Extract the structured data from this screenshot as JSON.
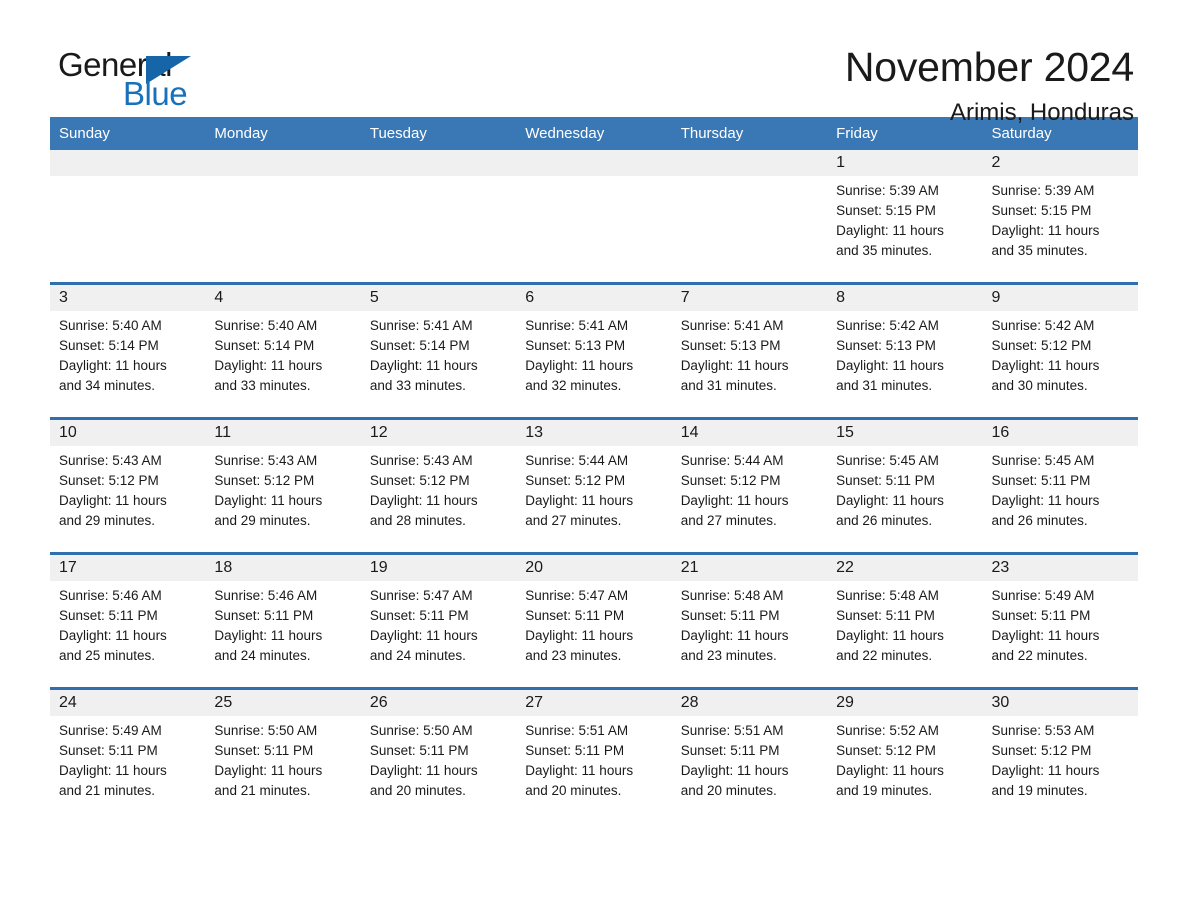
{
  "brand": {
    "name_top": "General",
    "name_bottom": "Blue",
    "triangle_color": "#1565a8",
    "blue_color": "#1772bb"
  },
  "header": {
    "title": "November 2024",
    "subtitle": "Arimis, Honduras"
  },
  "theme": {
    "header_row_bg": "#3a78b5",
    "week_divider": "#2f6fb0",
    "daynum_band_bg": "#f0f0f0",
    "text": "#1a1a1a"
  },
  "weekday_headers": [
    "Sunday",
    "Monday",
    "Tuesday",
    "Wednesday",
    "Thursday",
    "Friday",
    "Saturday"
  ],
  "weeks": [
    [
      {
        "day": "",
        "empty": true,
        "lines": []
      },
      {
        "day": "",
        "empty": true,
        "lines": []
      },
      {
        "day": "",
        "empty": true,
        "lines": []
      },
      {
        "day": "",
        "empty": true,
        "lines": []
      },
      {
        "day": "",
        "empty": true,
        "lines": []
      },
      {
        "day": "1",
        "empty": false,
        "lines": [
          "Sunrise: 5:39 AM",
          "Sunset: 5:15 PM",
          "Daylight: 11 hours",
          "and 35 minutes."
        ]
      },
      {
        "day": "2",
        "empty": false,
        "lines": [
          "Sunrise: 5:39 AM",
          "Sunset: 5:15 PM",
          "Daylight: 11 hours",
          "and 35 minutes."
        ]
      }
    ],
    [
      {
        "day": "3",
        "empty": false,
        "lines": [
          "Sunrise: 5:40 AM",
          "Sunset: 5:14 PM",
          "Daylight: 11 hours",
          "and 34 minutes."
        ]
      },
      {
        "day": "4",
        "empty": false,
        "lines": [
          "Sunrise: 5:40 AM",
          "Sunset: 5:14 PM",
          "Daylight: 11 hours",
          "and 33 minutes."
        ]
      },
      {
        "day": "5",
        "empty": false,
        "lines": [
          "Sunrise: 5:41 AM",
          "Sunset: 5:14 PM",
          "Daylight: 11 hours",
          "and 33 minutes."
        ]
      },
      {
        "day": "6",
        "empty": false,
        "lines": [
          "Sunrise: 5:41 AM",
          "Sunset: 5:13 PM",
          "Daylight: 11 hours",
          "and 32 minutes."
        ]
      },
      {
        "day": "7",
        "empty": false,
        "lines": [
          "Sunrise: 5:41 AM",
          "Sunset: 5:13 PM",
          "Daylight: 11 hours",
          "and 31 minutes."
        ]
      },
      {
        "day": "8",
        "empty": false,
        "lines": [
          "Sunrise: 5:42 AM",
          "Sunset: 5:13 PM",
          "Daylight: 11 hours",
          "and 31 minutes."
        ]
      },
      {
        "day": "9",
        "empty": false,
        "lines": [
          "Sunrise: 5:42 AM",
          "Sunset: 5:12 PM",
          "Daylight: 11 hours",
          "and 30 minutes."
        ]
      }
    ],
    [
      {
        "day": "10",
        "empty": false,
        "lines": [
          "Sunrise: 5:43 AM",
          "Sunset: 5:12 PM",
          "Daylight: 11 hours",
          "and 29 minutes."
        ]
      },
      {
        "day": "11",
        "empty": false,
        "lines": [
          "Sunrise: 5:43 AM",
          "Sunset: 5:12 PM",
          "Daylight: 11 hours",
          "and 29 minutes."
        ]
      },
      {
        "day": "12",
        "empty": false,
        "lines": [
          "Sunrise: 5:43 AM",
          "Sunset: 5:12 PM",
          "Daylight: 11 hours",
          "and 28 minutes."
        ]
      },
      {
        "day": "13",
        "empty": false,
        "lines": [
          "Sunrise: 5:44 AM",
          "Sunset: 5:12 PM",
          "Daylight: 11 hours",
          "and 27 minutes."
        ]
      },
      {
        "day": "14",
        "empty": false,
        "lines": [
          "Sunrise: 5:44 AM",
          "Sunset: 5:12 PM",
          "Daylight: 11 hours",
          "and 27 minutes."
        ]
      },
      {
        "day": "15",
        "empty": false,
        "lines": [
          "Sunrise: 5:45 AM",
          "Sunset: 5:11 PM",
          "Daylight: 11 hours",
          "and 26 minutes."
        ]
      },
      {
        "day": "16",
        "empty": false,
        "lines": [
          "Sunrise: 5:45 AM",
          "Sunset: 5:11 PM",
          "Daylight: 11 hours",
          "and 26 minutes."
        ]
      }
    ],
    [
      {
        "day": "17",
        "empty": false,
        "lines": [
          "Sunrise: 5:46 AM",
          "Sunset: 5:11 PM",
          "Daylight: 11 hours",
          "and 25 minutes."
        ]
      },
      {
        "day": "18",
        "empty": false,
        "lines": [
          "Sunrise: 5:46 AM",
          "Sunset: 5:11 PM",
          "Daylight: 11 hours",
          "and 24 minutes."
        ]
      },
      {
        "day": "19",
        "empty": false,
        "lines": [
          "Sunrise: 5:47 AM",
          "Sunset: 5:11 PM",
          "Daylight: 11 hours",
          "and 24 minutes."
        ]
      },
      {
        "day": "20",
        "empty": false,
        "lines": [
          "Sunrise: 5:47 AM",
          "Sunset: 5:11 PM",
          "Daylight: 11 hours",
          "and 23 minutes."
        ]
      },
      {
        "day": "21",
        "empty": false,
        "lines": [
          "Sunrise: 5:48 AM",
          "Sunset: 5:11 PM",
          "Daylight: 11 hours",
          "and 23 minutes."
        ]
      },
      {
        "day": "22",
        "empty": false,
        "lines": [
          "Sunrise: 5:48 AM",
          "Sunset: 5:11 PM",
          "Daylight: 11 hours",
          "and 22 minutes."
        ]
      },
      {
        "day": "23",
        "empty": false,
        "lines": [
          "Sunrise: 5:49 AM",
          "Sunset: 5:11 PM",
          "Daylight: 11 hours",
          "and 22 minutes."
        ]
      }
    ],
    [
      {
        "day": "24",
        "empty": false,
        "lines": [
          "Sunrise: 5:49 AM",
          "Sunset: 5:11 PM",
          "Daylight: 11 hours",
          "and 21 minutes."
        ]
      },
      {
        "day": "25",
        "empty": false,
        "lines": [
          "Sunrise: 5:50 AM",
          "Sunset: 5:11 PM",
          "Daylight: 11 hours",
          "and 21 minutes."
        ]
      },
      {
        "day": "26",
        "empty": false,
        "lines": [
          "Sunrise: 5:50 AM",
          "Sunset: 5:11 PM",
          "Daylight: 11 hours",
          "and 20 minutes."
        ]
      },
      {
        "day": "27",
        "empty": false,
        "lines": [
          "Sunrise: 5:51 AM",
          "Sunset: 5:11 PM",
          "Daylight: 11 hours",
          "and 20 minutes."
        ]
      },
      {
        "day": "28",
        "empty": false,
        "lines": [
          "Sunrise: 5:51 AM",
          "Sunset: 5:11 PM",
          "Daylight: 11 hours",
          "and 20 minutes."
        ]
      },
      {
        "day": "29",
        "empty": false,
        "lines": [
          "Sunrise: 5:52 AM",
          "Sunset: 5:12 PM",
          "Daylight: 11 hours",
          "and 19 minutes."
        ]
      },
      {
        "day": "30",
        "empty": false,
        "lines": [
          "Sunrise: 5:53 AM",
          "Sunset: 5:12 PM",
          "Daylight: 11 hours",
          "and 19 minutes."
        ]
      }
    ]
  ]
}
